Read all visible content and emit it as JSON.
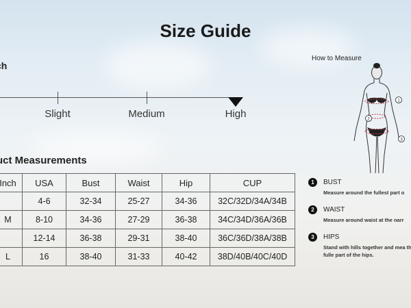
{
  "title": "Size Guide",
  "stretch": {
    "label": "ch",
    "levels": [
      "Slight",
      "Medium",
      "High"
    ],
    "selected": "High"
  },
  "measurements": {
    "title": "uct Measurements",
    "columns": [
      "Inch",
      "USA",
      "Bust",
      "Waist",
      "Hip",
      "CUP"
    ],
    "rows": [
      [
        "",
        "4-6",
        "32-34",
        "25-27",
        "34-36",
        "32C/32D/34A/34B"
      ],
      [
        "M",
        "8-10",
        "34-36",
        "27-29",
        "36-38",
        "34C/34D/36A/36B"
      ],
      [
        "",
        "12-14",
        "36-38",
        "29-31",
        "38-40",
        "36C/36D/38A/38B"
      ],
      [
        "L",
        "16",
        "38-40",
        "31-33",
        "40-42",
        "38D/40B/40C/40D"
      ]
    ]
  },
  "how_to_measure": {
    "title": "How to Measure",
    "figure_markers": [
      "1",
      "2",
      "3"
    ],
    "steps": [
      {
        "num": "1",
        "head": "BUST",
        "desc": "Measure around the fullest part o"
      },
      {
        "num": "2",
        "head": "WAIST",
        "desc": "Measure around waist at the narr"
      },
      {
        "num": "3",
        "head": "HIPS",
        "desc": "Stand with hills together and mea the fulle part of the hips."
      }
    ]
  },
  "colors": {
    "text": "#222222",
    "sky_top": "#d4e3ef",
    "sand": "#e8e6e1",
    "marker": "#111111",
    "measure_line": "#c0394b"
  }
}
